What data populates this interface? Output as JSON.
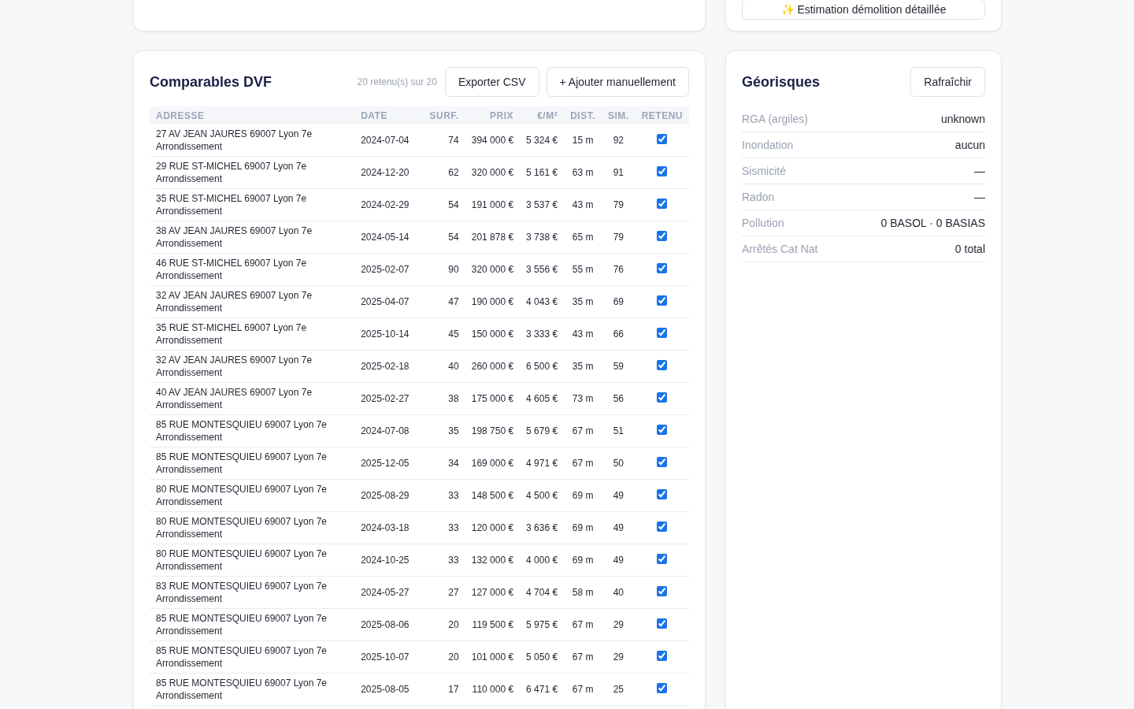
{
  "top_right_card": {
    "button": "✨ Estimation démolition détaillée"
  },
  "comparables": {
    "title": "Comparables DVF",
    "count": "20 retenu(s) sur 20",
    "buttons": [
      "Exporter CSV",
      "+ Ajouter manuellement"
    ],
    "columns": [
      "ADRESSE",
      "DATE",
      "SURF.",
      "PRIX",
      "€/M²",
      "DIST.",
      "SIM.",
      "RETENU"
    ],
    "rows": [
      {
        "address": "27 AV JEAN JAURES 69007 Lyon 7e Arrondissement",
        "date": "2024-07-04",
        "surface": "74",
        "price": "394 000 €",
        "per_m2": "5 324 €",
        "distance": "15 m",
        "similarity": "92",
        "checked": true
      },
      {
        "address": "29 RUE ST-MICHEL 69007 Lyon 7e Arrondissement",
        "date": "2024-12-20",
        "surface": "62",
        "price": "320 000 €",
        "per_m2": "5 161 €",
        "distance": "63 m",
        "similarity": "91",
        "checked": true
      },
      {
        "address": "35 RUE ST-MICHEL 69007 Lyon 7e Arrondissement",
        "date": "2024-02-29",
        "surface": "54",
        "price": "191 000 €",
        "per_m2": "3 537 €",
        "distance": "43 m",
        "similarity": "79",
        "checked": true
      },
      {
        "address": "38 AV JEAN JAURES 69007 Lyon 7e Arrondissement",
        "date": "2024-05-14",
        "surface": "54",
        "price": "201 878 €",
        "per_m2": "3 738 €",
        "distance": "65 m",
        "similarity": "79",
        "checked": true
      },
      {
        "address": "46 RUE ST-MICHEL 69007 Lyon 7e Arrondissement",
        "date": "2025-02-07",
        "surface": "90",
        "price": "320 000 €",
        "per_m2": "3 556 €",
        "distance": "55 m",
        "similarity": "76",
        "checked": true
      },
      {
        "address": "32 AV JEAN JAURES 69007 Lyon 7e Arrondissement",
        "date": "2025-04-07",
        "surface": "47",
        "price": "190 000 €",
        "per_m2": "4 043 €",
        "distance": "35 m",
        "similarity": "69",
        "checked": true
      },
      {
        "address": "35 RUE ST-MICHEL 69007 Lyon 7e Arrondissement",
        "date": "2025-10-14",
        "surface": "45",
        "price": "150 000 €",
        "per_m2": "3 333 €",
        "distance": "43 m",
        "similarity": "66",
        "checked": true
      },
      {
        "address": "32 AV JEAN JAURES 69007 Lyon 7e Arrondissement",
        "date": "2025-02-18",
        "surface": "40",
        "price": "260 000 €",
        "per_m2": "6 500 €",
        "distance": "35 m",
        "similarity": "59",
        "checked": true
      },
      {
        "address": "40 AV JEAN JAURES 69007 Lyon 7e Arrondissement",
        "date": "2025-02-27",
        "surface": "38",
        "price": "175 000 €",
        "per_m2": "4 605 €",
        "distance": "73 m",
        "similarity": "56",
        "checked": true
      },
      {
        "address": "85 RUE MONTESQUIEU 69007 Lyon 7e Arrondissement",
        "date": "2024-07-08",
        "surface": "35",
        "price": "198 750 €",
        "per_m2": "5 679 €",
        "distance": "67 m",
        "similarity": "51",
        "checked": true
      },
      {
        "address": "85 RUE MONTESQUIEU 69007 Lyon 7e Arrondissement",
        "date": "2025-12-05",
        "surface": "34",
        "price": "169 000 €",
        "per_m2": "4 971 €",
        "distance": "67 m",
        "similarity": "50",
        "checked": true
      },
      {
        "address": "80 RUE MONTESQUIEU 69007 Lyon 7e Arrondissement",
        "date": "2025-08-29",
        "surface": "33",
        "price": "148 500 €",
        "per_m2": "4 500 €",
        "distance": "69 m",
        "similarity": "49",
        "checked": true
      },
      {
        "address": "80 RUE MONTESQUIEU 69007 Lyon 7e Arrondissement",
        "date": "2024-03-18",
        "surface": "33",
        "price": "120 000 €",
        "per_m2": "3 636 €",
        "distance": "69 m",
        "similarity": "49",
        "checked": true
      },
      {
        "address": "80 RUE MONTESQUIEU 69007 Lyon 7e Arrondissement",
        "date": "2024-10-25",
        "surface": "33",
        "price": "132 000 €",
        "per_m2": "4 000 €",
        "distance": "69 m",
        "similarity": "49",
        "checked": true
      },
      {
        "address": "83 RUE MONTESQUIEU 69007 Lyon 7e Arrondissement",
        "date": "2024-05-27",
        "surface": "27",
        "price": "127 000 €",
        "per_m2": "4 704 €",
        "distance": "58 m",
        "similarity": "40",
        "checked": true
      },
      {
        "address": "85 RUE MONTESQUIEU 69007 Lyon 7e Arrondissement",
        "date": "2025-08-06",
        "surface": "20",
        "price": "119 500 €",
        "per_m2": "5 975 €",
        "distance": "67 m",
        "similarity": "29",
        "checked": true
      },
      {
        "address": "85 RUE MONTESQUIEU 69007 Lyon 7e Arrondissement",
        "date": "2025-10-07",
        "surface": "20",
        "price": "101 000 €",
        "per_m2": "5 050 €",
        "distance": "67 m",
        "similarity": "29",
        "checked": true
      },
      {
        "address": "85 RUE MONTESQUIEU 69007 Lyon 7e Arrondissement",
        "date": "2025-08-05",
        "surface": "17",
        "price": "110 000 €",
        "per_m2": "6 471 €",
        "distance": "67 m",
        "similarity": "25",
        "checked": true
      }
    ]
  },
  "georisques": {
    "title": "Géorisques",
    "button": "Rafraîchir",
    "items": [
      {
        "label": "RGA (argiles)",
        "value": "unknown"
      },
      {
        "label": "Inondation",
        "value": "aucun"
      },
      {
        "label": "Sismicité",
        "value": "—"
      },
      {
        "label": "Radon",
        "value": "—"
      },
      {
        "label": "Pollution",
        "value": "0 BASOL · 0 BASIAS"
      },
      {
        "label": "Arrêtés Cat Nat",
        "value": "0 total"
      }
    ]
  }
}
